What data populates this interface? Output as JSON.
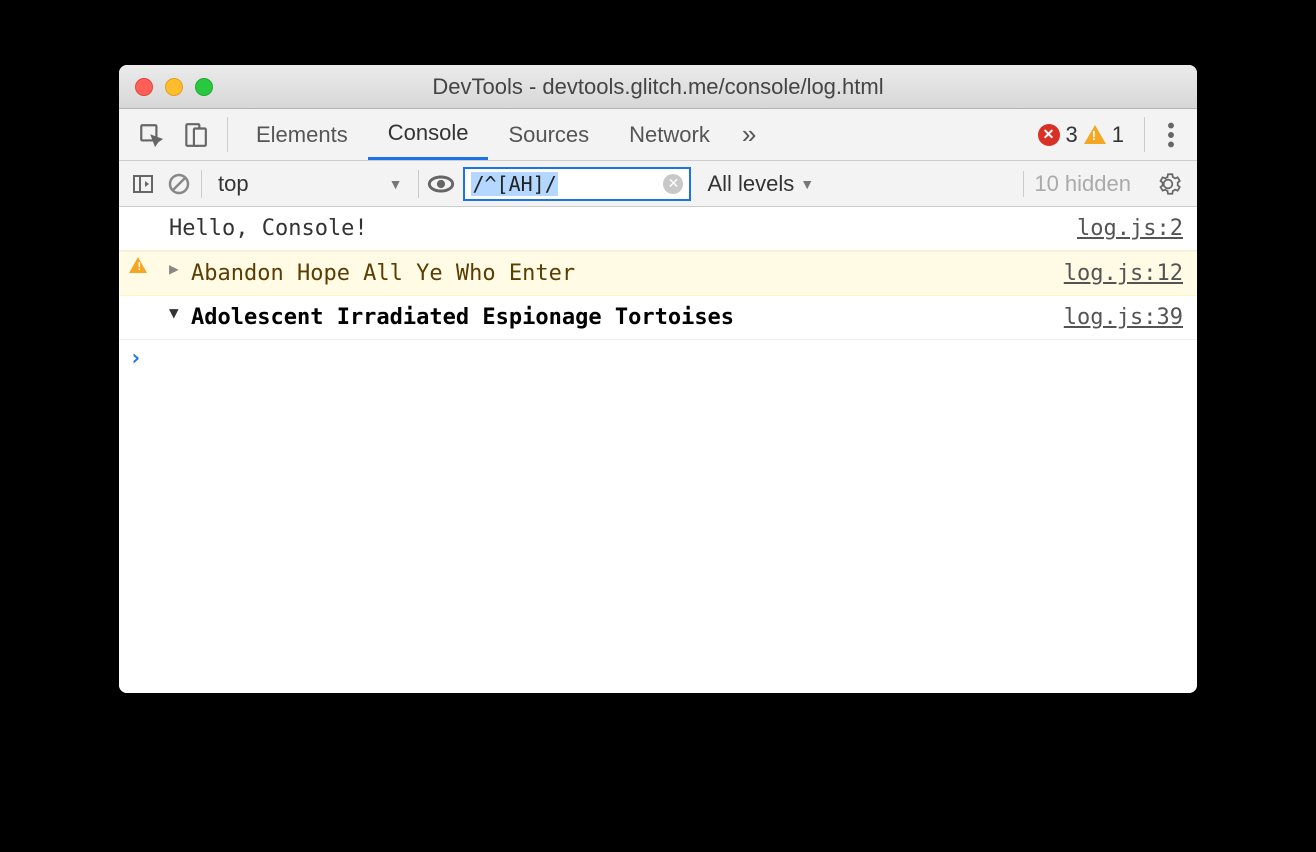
{
  "window": {
    "title": "DevTools - devtools.glitch.me/console/log.html"
  },
  "tabs": {
    "elements": "Elements",
    "console": "Console",
    "sources": "Sources",
    "network": "Network"
  },
  "status": {
    "errors": "3",
    "warnings": "1"
  },
  "toolbar": {
    "context": "top",
    "filter": "/^[AH]/",
    "levels": "All levels",
    "hidden": "10 hidden"
  },
  "messages": [
    {
      "type": "log",
      "text": "Hello, Console!",
      "source": "log.js:2"
    },
    {
      "type": "warn",
      "text": "Abandon Hope All Ye Who Enter",
      "source": "log.js:12"
    },
    {
      "type": "group",
      "text": "Adolescent Irradiated Espionage Tortoises",
      "source": "log.js:39"
    }
  ]
}
